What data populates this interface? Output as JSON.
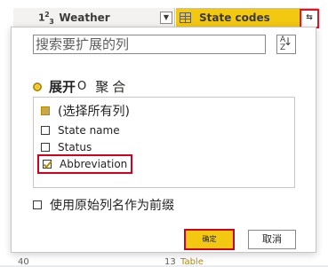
{
  "grid": {
    "columns": [
      {
        "type_icon": "123",
        "name": "Weather"
      },
      {
        "type_icon": "table",
        "name": "State codes"
      }
    ],
    "footer_row": {
      "row_number": "40",
      "value": "13",
      "link": "Table"
    }
  },
  "popup": {
    "search_placeholder": "搜索要扩展的列",
    "sort_icon": "sort-az-icon",
    "mode": {
      "expand_label": "展开",
      "aggregate_label": "聚合",
      "selected": "expand"
    },
    "columns_list": [
      {
        "label": "(选择所有列)",
        "state": "partial"
      },
      {
        "label": "State name",
        "checked": false
      },
      {
        "label": "Status",
        "checked": false
      },
      {
        "label": "Abbreviation",
        "checked": true
      }
    ],
    "use_original_prefix_label": "使用原始列名作为前缀",
    "use_original_prefix_checked": false,
    "ok_label": "确定",
    "cancel_label": "取消"
  },
  "colors": {
    "accent": "#f2c811",
    "highlight_border": "#d0021b",
    "checkmark": "#b58900"
  }
}
